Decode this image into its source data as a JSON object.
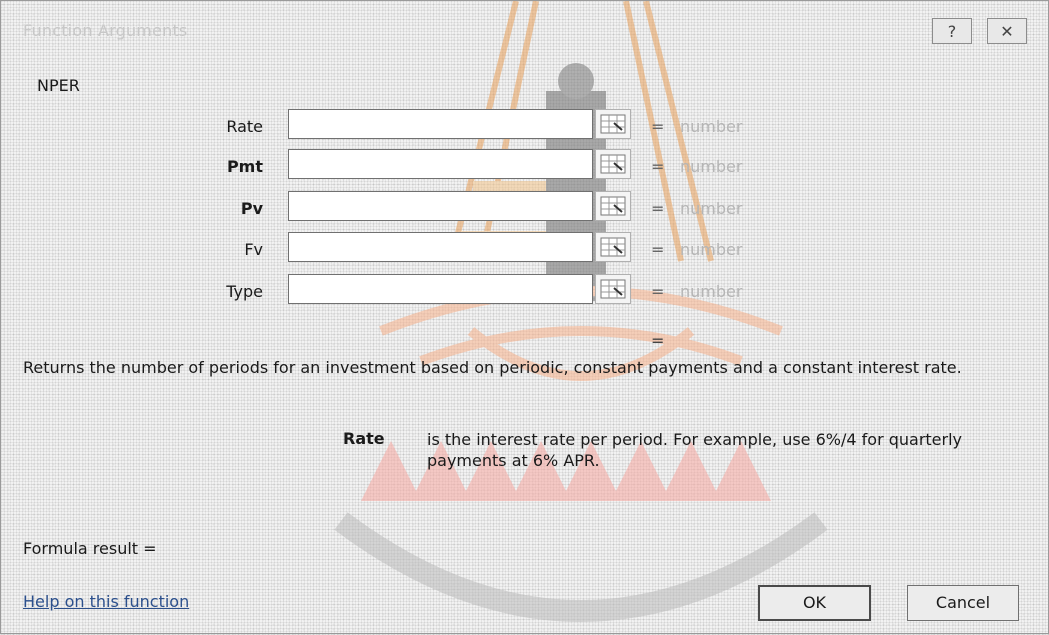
{
  "window": {
    "title": "Function Arguments",
    "help_button": "?",
    "close_button": "✕"
  },
  "function_name": "NPER",
  "arguments": [
    {
      "label": "Rate",
      "bold": false,
      "value": "",
      "hint": "number"
    },
    {
      "label": "Pmt",
      "bold": true,
      "value": "",
      "hint": "number"
    },
    {
      "label": "Pv",
      "bold": true,
      "value": "",
      "hint": "number"
    },
    {
      "label": "Fv",
      "bold": false,
      "value": "",
      "hint": "number"
    },
    {
      "label": "Type",
      "bold": false,
      "value": "",
      "hint": "number"
    }
  ],
  "equals_sign": "=",
  "description": "Returns the number of periods for an investment based on periodic, constant payments and a constant interest rate.",
  "argument_help": {
    "label": "Rate",
    "text": "is the interest rate per period. For example, use 6%/4 for quarterly payments at 6% APR."
  },
  "formula_result_label": "Formula result =",
  "help_link": "Help on this function",
  "buttons": {
    "ok": "OK",
    "cancel": "Cancel"
  }
}
